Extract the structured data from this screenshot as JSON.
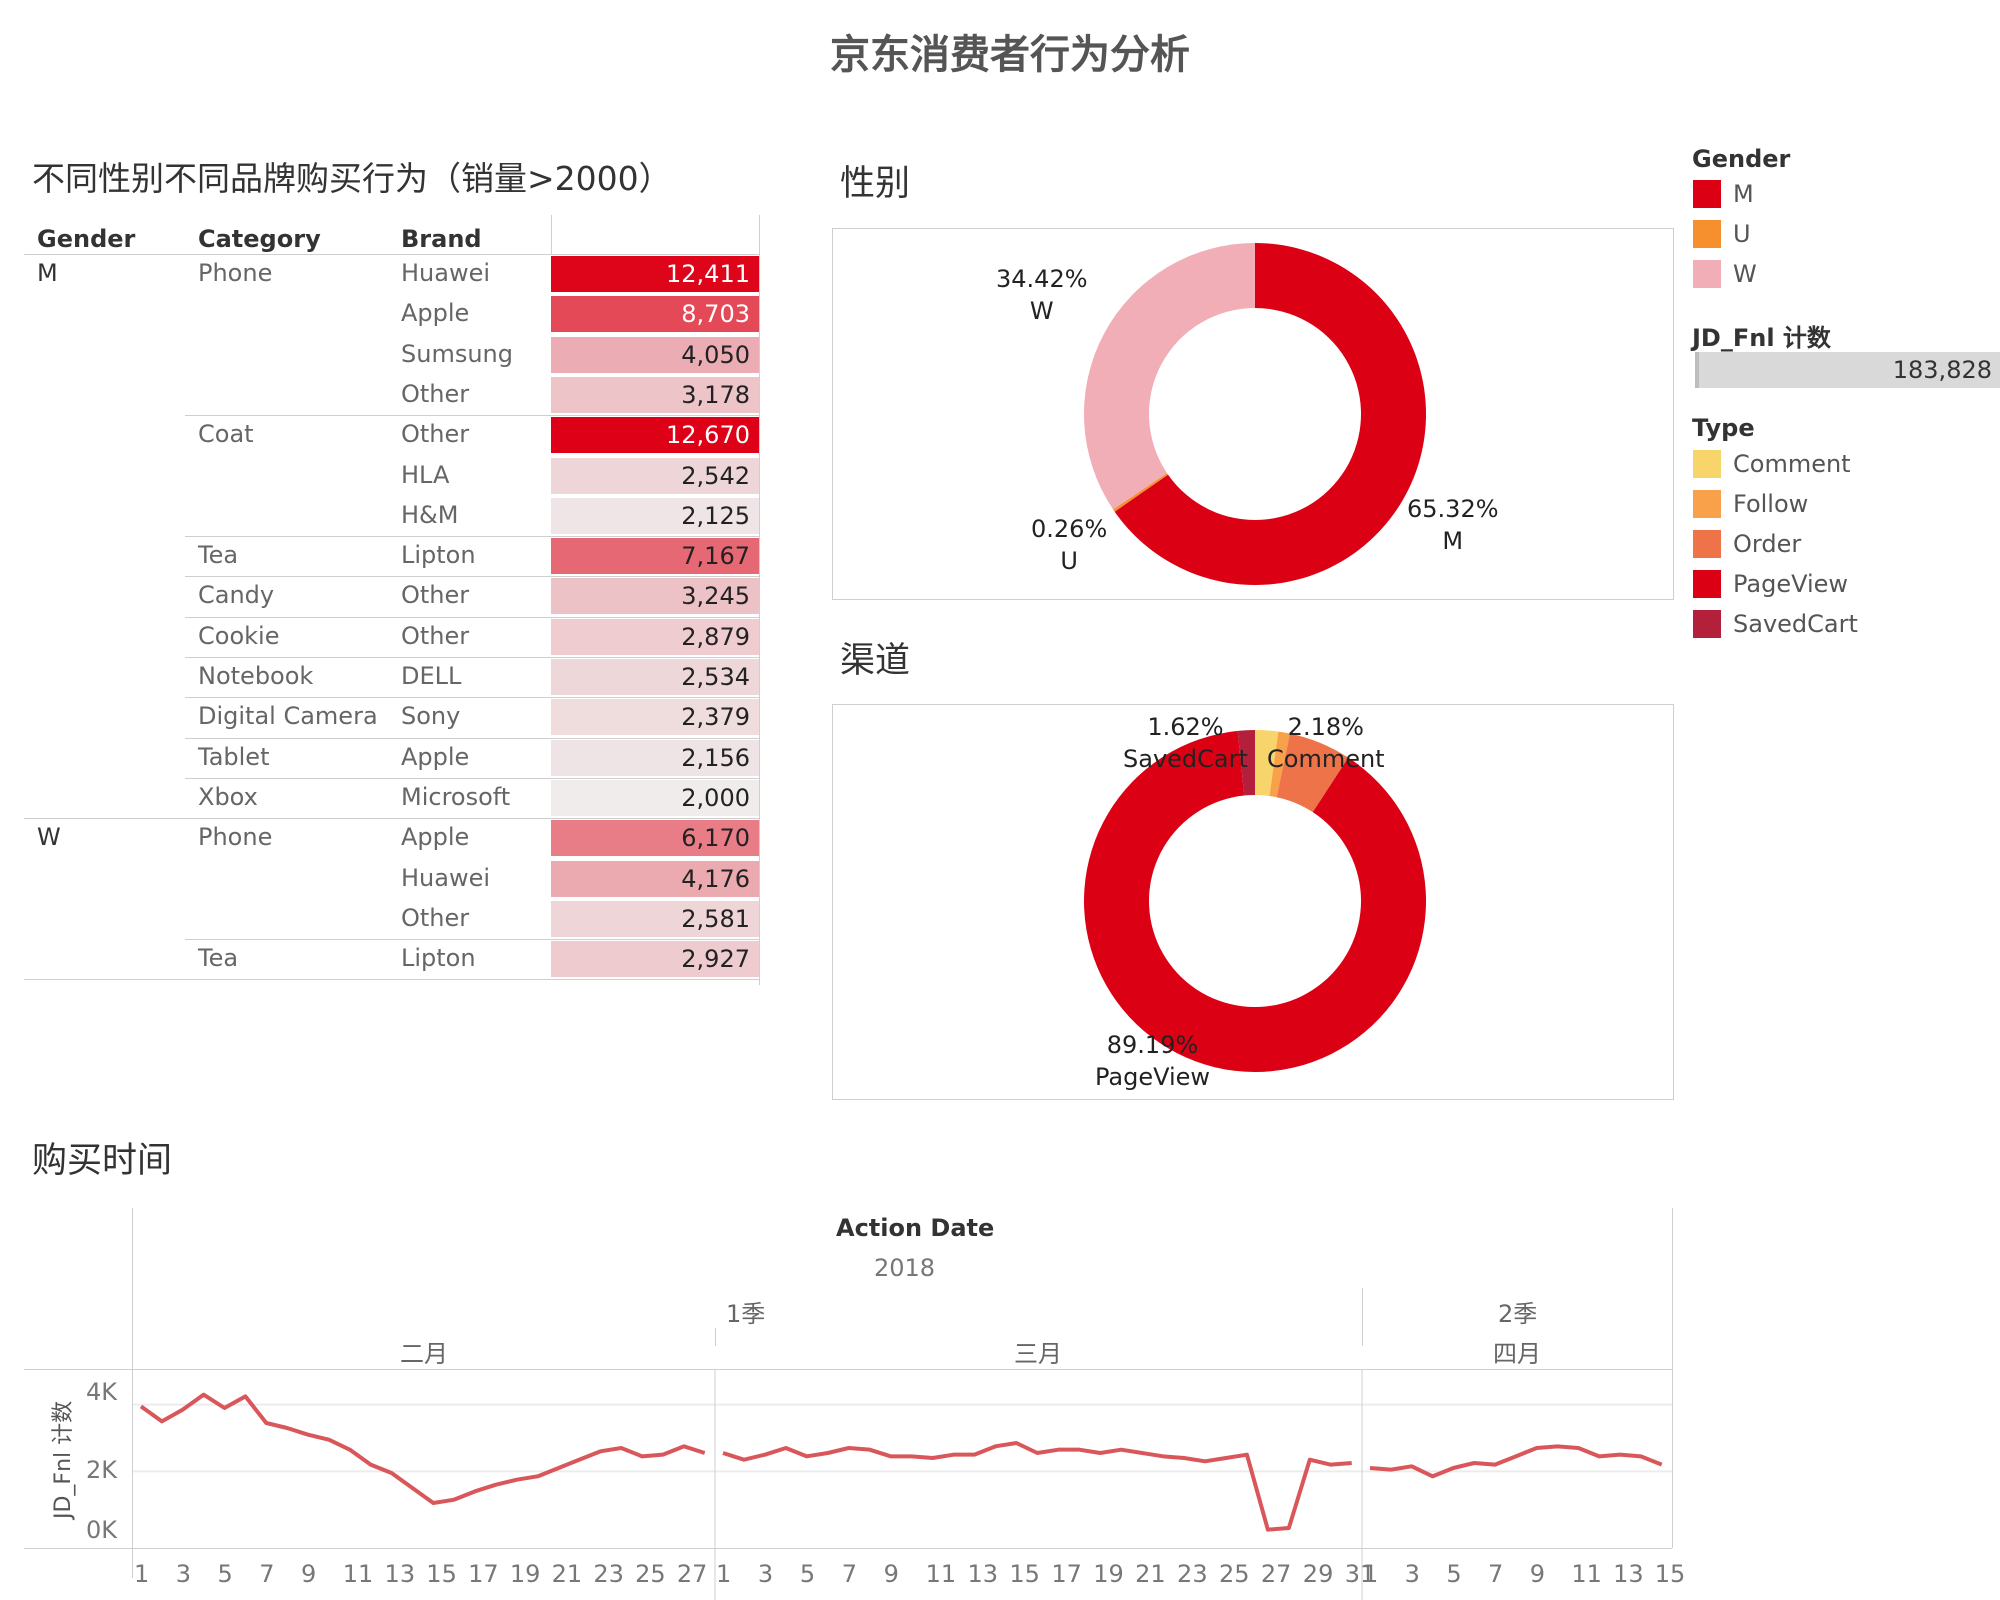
{
  "title": "京东消费者行为分析",
  "table": {
    "title": "不同性别不同品牌购买行为（销量>2000）",
    "headers": {
      "gender": "Gender",
      "category": "Category",
      "brand": "Brand"
    },
    "rows": [
      {
        "gender": "M",
        "category": "Phone",
        "brand": "Huawei",
        "value": "12,411",
        "num": 12411
      },
      {
        "gender": "",
        "category": "",
        "brand": "Apple",
        "value": "8,703",
        "num": 8703
      },
      {
        "gender": "",
        "category": "",
        "brand": "Sumsung",
        "value": "4,050",
        "num": 4050
      },
      {
        "gender": "",
        "category": "",
        "brand": "Other",
        "value": "3,178",
        "num": 3178
      },
      {
        "gender": "",
        "category": "Coat",
        "brand": "Other",
        "value": "12,670",
        "num": 12670
      },
      {
        "gender": "",
        "category": "",
        "brand": "HLA",
        "value": "2,542",
        "num": 2542
      },
      {
        "gender": "",
        "category": "",
        "brand": "H&M",
        "value": "2,125",
        "num": 2125
      },
      {
        "gender": "",
        "category": "Tea",
        "brand": "Lipton",
        "value": "7,167",
        "num": 7167
      },
      {
        "gender": "",
        "category": "Candy",
        "brand": "Other",
        "value": "3,245",
        "num": 3245
      },
      {
        "gender": "",
        "category": "Cookie",
        "brand": "Other",
        "value": "2,879",
        "num": 2879
      },
      {
        "gender": "",
        "category": "Notebook",
        "brand": "DELL",
        "value": "2,534",
        "num": 2534
      },
      {
        "gender": "",
        "category": "Digital Camera",
        "brand": "Sony",
        "value": "2,379",
        "num": 2379
      },
      {
        "gender": "",
        "category": "Tablet",
        "brand": "Apple",
        "value": "2,156",
        "num": 2156
      },
      {
        "gender": "",
        "category": "Xbox",
        "brand": "Microsoft",
        "value": "2,000",
        "num": 2000
      },
      {
        "gender": "W",
        "category": "Phone",
        "brand": "Apple",
        "value": "6,170",
        "num": 6170
      },
      {
        "gender": "",
        "category": "",
        "brand": "Huawei",
        "value": "4,176",
        "num": 4176
      },
      {
        "gender": "",
        "category": "",
        "brand": "Other",
        "value": "2,581",
        "num": 2581
      },
      {
        "gender": "",
        "category": "Tea",
        "brand": "Lipton",
        "value": "2,927",
        "num": 2927
      }
    ]
  },
  "gender_section": {
    "title": "性别",
    "labels": {
      "W": {
        "pct": "34.42%",
        "name": "W"
      },
      "U": {
        "pct": "0.26%",
        "name": "U"
      },
      "M": {
        "pct": "65.32%",
        "name": "M"
      }
    }
  },
  "channel_section": {
    "title": "渠道",
    "labels": {
      "SavedCart": {
        "pct": "1.62%",
        "name": "SavedCart"
      },
      "Comment": {
        "pct": "2.18%",
        "name": "Comment"
      },
      "PageView": {
        "pct": "89.19%",
        "name": "PageView"
      }
    }
  },
  "legend": {
    "gender_title": "Gender",
    "gender_items": [
      {
        "label": "M",
        "color": "#dc0014"
      },
      {
        "label": "U",
        "color": "#f6902f"
      },
      {
        "label": "W",
        "color": "#f1aeb6"
      }
    ],
    "count_title": "JD_Fnl 计数",
    "count_value": "183,828",
    "type_title": "Type",
    "type_items": [
      {
        "label": "Comment",
        "color": "#f7d56a"
      },
      {
        "label": "Follow",
        "color": "#f9a04b"
      },
      {
        "label": "Order",
        "color": "#ee7348"
      },
      {
        "label": "PageView",
        "color": "#dc0014"
      },
      {
        "label": "SavedCart",
        "color": "#b41f3c"
      }
    ]
  },
  "time_section": {
    "title": "购买时间",
    "axis_title": "Action Date",
    "year": "2018",
    "quarters": [
      "1季",
      "2季"
    ],
    "months": [
      "二月",
      "三月",
      "四月"
    ],
    "ylabel": "JD_Fnl 计数",
    "yticks": [
      "4K",
      "2K",
      "0K"
    ],
    "xticks_feb": [
      "1",
      "3",
      "5",
      "7",
      "9",
      "11",
      "13",
      "15",
      "17",
      "19",
      "21",
      "23",
      "25",
      "27"
    ],
    "xticks_mar": [
      "1",
      "3",
      "5",
      "7",
      "9",
      "11",
      "13",
      "15",
      "17",
      "19",
      "21",
      "23",
      "25",
      "27",
      "29",
      "31"
    ],
    "xticks_apr": [
      "1",
      "3",
      "5",
      "7",
      "9",
      "11",
      "13",
      "15"
    ]
  },
  "chart_data": [
    {
      "type": "pie",
      "title": "性别",
      "categories": [
        "M",
        "U",
        "W"
      ],
      "values": [
        65.32,
        0.26,
        34.42
      ],
      "colors": [
        "#dc0014",
        "#f6902f",
        "#f1aeb6"
      ]
    },
    {
      "type": "pie",
      "title": "渠道",
      "categories": [
        "PageView",
        "Order",
        "Follow",
        "Comment",
        "SavedCart"
      ],
      "values": [
        89.19,
        5.9,
        1.1,
        2.18,
        1.62
      ],
      "colors": [
        "#dc0014",
        "#ee7348",
        "#f9a04b",
        "#f7d56a",
        "#b41f3c"
      ]
    },
    {
      "type": "line",
      "title": "购买时间",
      "xlabel": "Action Date",
      "ylabel": "JD_Fnl 计数",
      "ylim": [
        0,
        4500
      ],
      "series": [
        {
          "name": "二月",
          "x": [
            1,
            2,
            3,
            4,
            5,
            6,
            7,
            8,
            9,
            10,
            11,
            12,
            13,
            14,
            15,
            16,
            17,
            18,
            19,
            20,
            21,
            22,
            23,
            24,
            25,
            26,
            27,
            28
          ],
          "values": [
            3950,
            3500,
            3850,
            4300,
            3900,
            4250,
            3450,
            3300,
            3100,
            2950,
            2650,
            2200,
            1950,
            1500,
            1050,
            1150,
            1400,
            1600,
            1750,
            1850,
            2100,
            2350,
            2600,
            2700,
            2450,
            2500,
            2750,
            2550
          ]
        },
        {
          "name": "三月",
          "x": [
            1,
            2,
            3,
            4,
            5,
            6,
            7,
            8,
            9,
            10,
            11,
            12,
            13,
            14,
            15,
            16,
            17,
            18,
            19,
            20,
            21,
            22,
            23,
            24,
            25,
            26,
            27,
            28,
            29,
            30,
            31
          ],
          "values": [
            2550,
            2350,
            2500,
            2700,
            2450,
            2550,
            2700,
            2650,
            2450,
            2450,
            2400,
            2500,
            2500,
            2750,
            2850,
            2550,
            2650,
            2650,
            2550,
            2650,
            2550,
            2450,
            2400,
            2300,
            2400,
            2500,
            250,
            300,
            2350,
            2200,
            2250
          ]
        },
        {
          "name": "四月",
          "x": [
            1,
            2,
            3,
            4,
            5,
            6,
            7,
            8,
            9,
            10,
            11,
            12,
            13,
            14,
            15
          ],
          "values": [
            2100,
            2050,
            2150,
            1850,
            2100,
            2250,
            2200,
            2450,
            2700,
            2750,
            2700,
            2450,
            2500,
            2450,
            2200
          ]
        }
      ]
    }
  ]
}
